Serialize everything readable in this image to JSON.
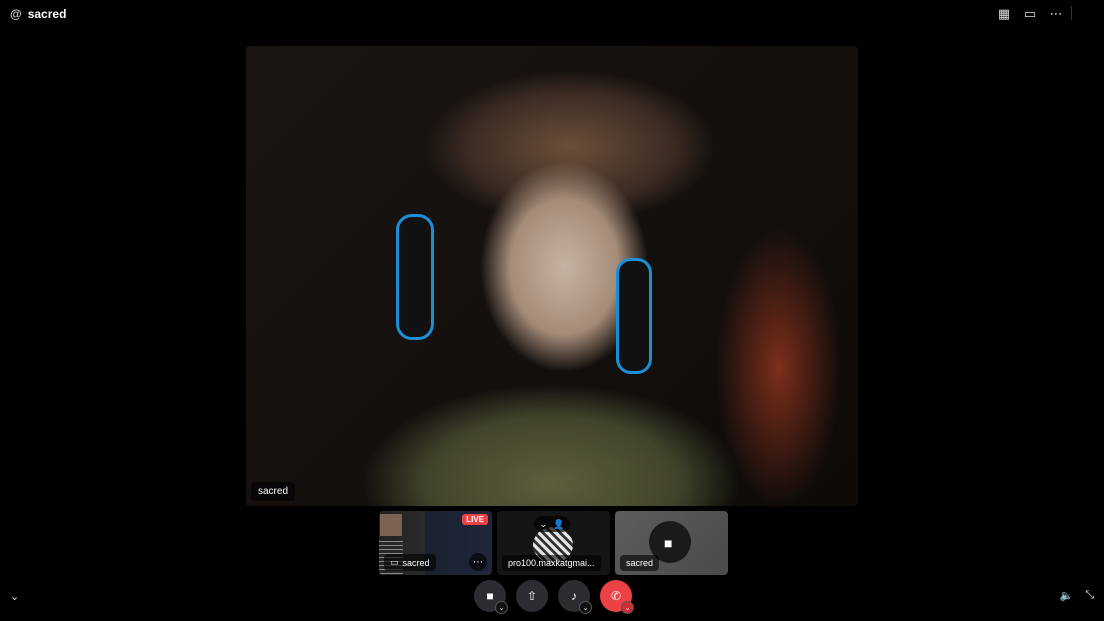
{
  "window": {
    "title": "sacred"
  },
  "icons": {
    "at": "@",
    "grid": "▦",
    "chat": "▭",
    "more": "⋯",
    "camera": "■",
    "screen": "⇧",
    "mic": "♪",
    "end_call": "✆",
    "caret": "⌄",
    "volume": "🔈",
    "collapse": "⤡",
    "chevron_down": "⌄"
  },
  "main_video": {
    "name": "sacred"
  },
  "thumbnails": [
    {
      "name": "sacred",
      "badge": "LIVE"
    },
    {
      "name": "pro100.maxkatgmai..."
    },
    {
      "name": "sacred"
    }
  ]
}
